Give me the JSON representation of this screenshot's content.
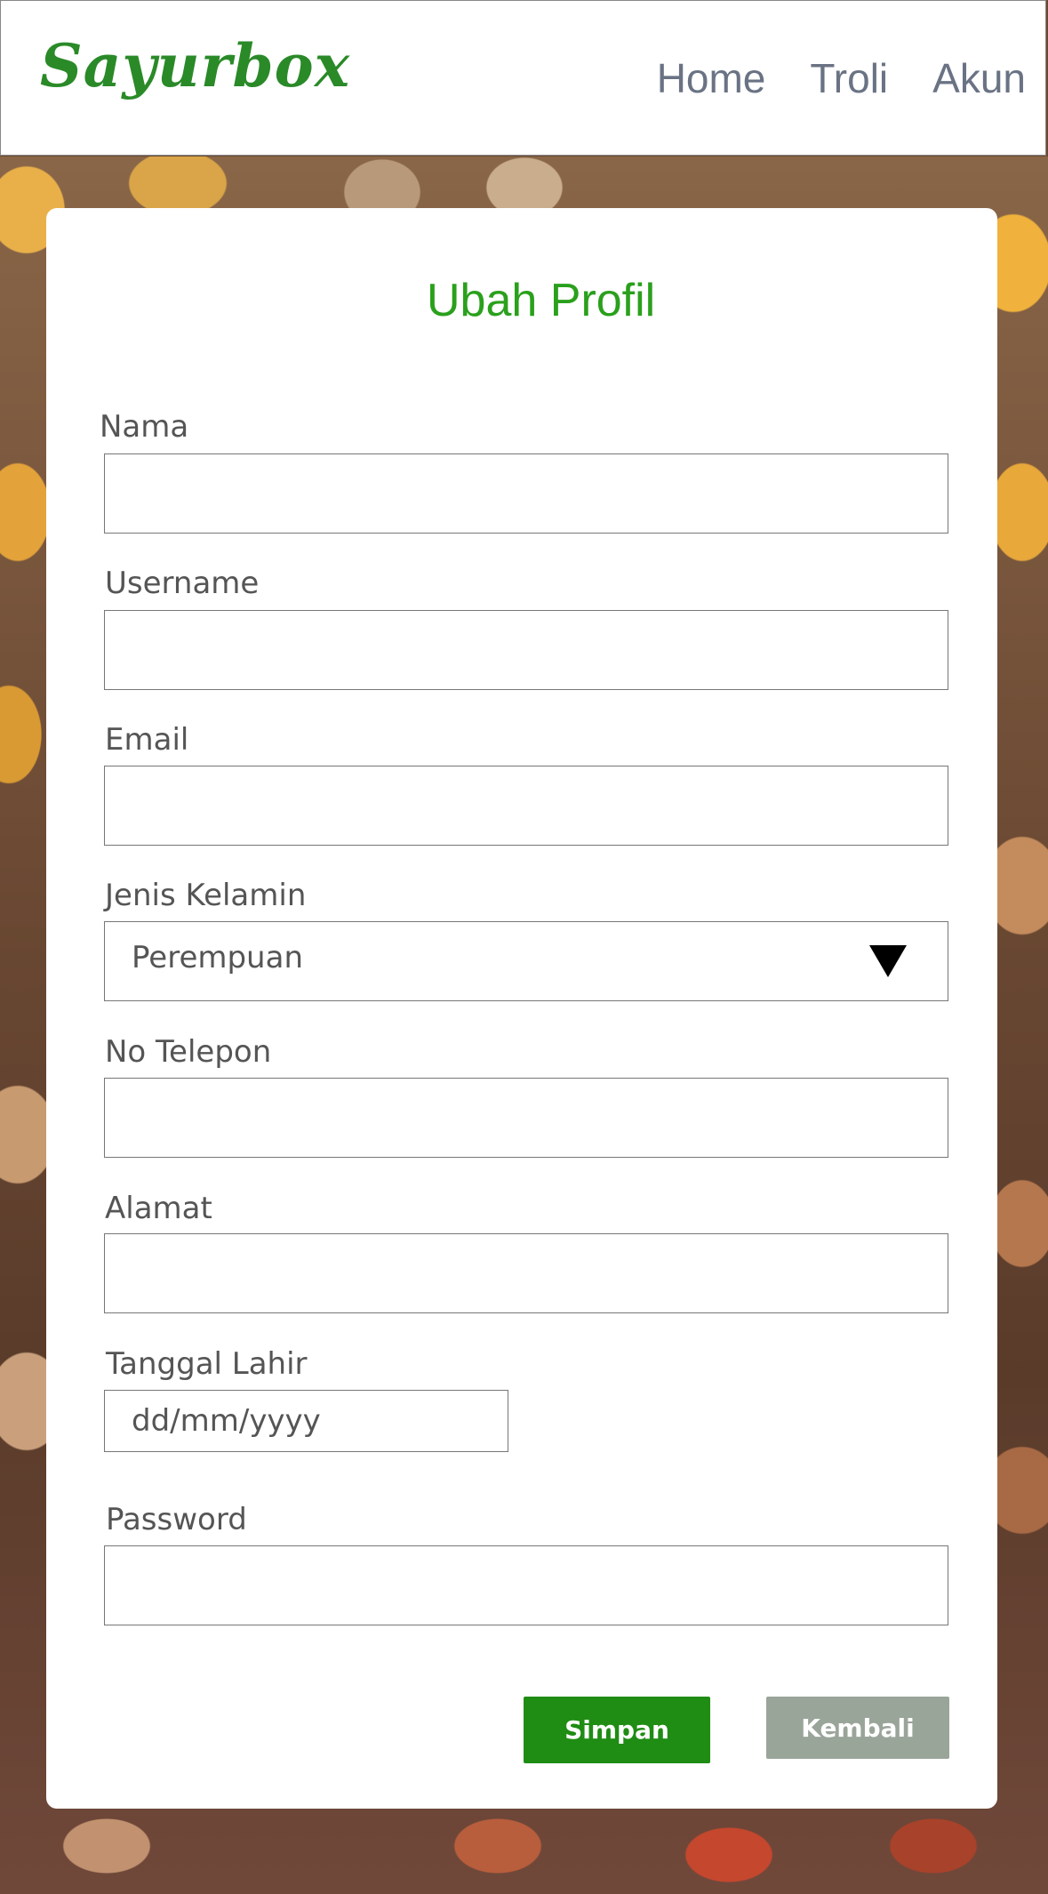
{
  "header": {
    "logo": "Sayurbox",
    "nav": [
      "Home",
      "Troli",
      "Akun"
    ]
  },
  "form": {
    "title": "Ubah Profil",
    "fields": {
      "nama": {
        "label": "Nama",
        "value": ""
      },
      "username": {
        "label": "Username",
        "value": ""
      },
      "email": {
        "label": "Email",
        "value": ""
      },
      "gender": {
        "label": "Jenis Kelamin",
        "selected": "Perempuan"
      },
      "phone": {
        "label": "No Telepon",
        "value": ""
      },
      "alamat": {
        "label": "Alamat",
        "value": ""
      },
      "birthdate": {
        "label": "Tanggal Lahir",
        "placeholder": "dd/mm/yyyy"
      },
      "password": {
        "label": "Password",
        "value": ""
      }
    },
    "buttons": {
      "save": "Simpan",
      "back": "Kembali"
    }
  },
  "colors": {
    "brand": "#2a8a28",
    "title": "#2aa01c",
    "save_button": "#1f8c14",
    "back_button": "#9aa59a",
    "nav_text": "#6a7384"
  }
}
